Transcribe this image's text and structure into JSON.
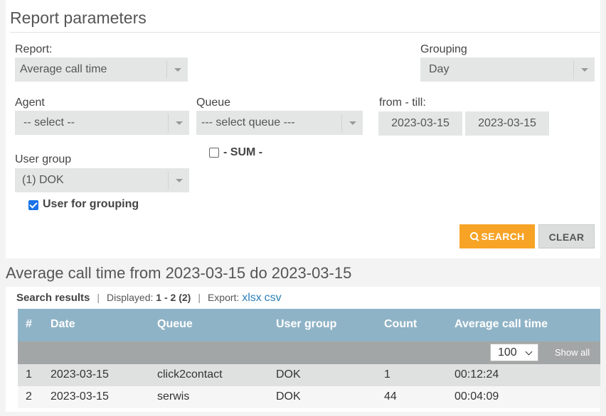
{
  "params": {
    "title": "Report parameters",
    "report_label": "Report:",
    "report_value": "Average call time",
    "grouping_label": "Grouping",
    "grouping_value": "Day",
    "agent_label": "Agent",
    "agent_value": "-- select --",
    "queue_label": "Queue",
    "queue_value": "--- select queue ---",
    "fromtill_label": "from - till:",
    "date_from": "2023-03-15",
    "date_till": "2023-03-15",
    "sum_label": "- SUM -",
    "sum_checked": false,
    "usergroup_label": "User group",
    "usergroup_value": "(1) DOK",
    "user_for_grouping_label": "User for grouping",
    "user_for_grouping_checked": true,
    "search_label": "SEARCH",
    "clear_label": "CLEAR"
  },
  "results": {
    "title": "Average call time from 2023-03-15 do 2023-03-15",
    "summary_label": "Search results",
    "displayed_label": "Displayed:",
    "displayed_value": "1 - 2 (2)",
    "export_label": "Export:",
    "export_xlsx": "xlsx",
    "export_csv": "csv",
    "columns": [
      "#",
      "Date",
      "Queue",
      "User group",
      "Count",
      "Average call time"
    ],
    "per_page": "100",
    "show_all": "Show all",
    "rows": [
      [
        "1",
        "2023-03-15",
        "click2contact",
        "DOK",
        "1",
        "00:12:24"
      ],
      [
        "2",
        "2023-03-15",
        "serwis",
        "DOK",
        "44",
        "00:04:09"
      ]
    ]
  },
  "colors": {
    "accent": "#f7a326",
    "table_header": "#8fb3c6",
    "link": "#2c7fb8"
  }
}
